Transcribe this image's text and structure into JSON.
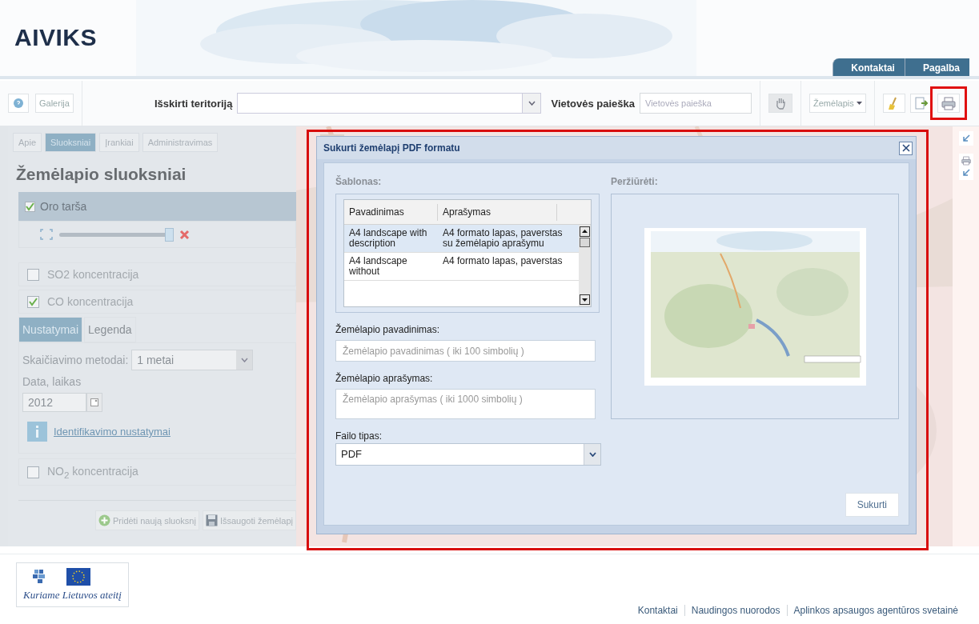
{
  "header": {
    "logo": "AIVIKS",
    "tabs": [
      "Kontaktai",
      "Pagalba"
    ]
  },
  "toolbar": {
    "gallery_button": "Galerija",
    "territory_label": "Išskirti teritoriją",
    "search_label": "Vietovės paieška",
    "search": {
      "placeholder": "Vietovės paieška"
    },
    "map_menu": "Žemėlapis",
    "tools": [
      {
        "kind": "broom",
        "highlighted": false
      },
      {
        "kind": "export",
        "highlighted": false
      },
      {
        "kind": "print",
        "highlighted": true
      }
    ]
  },
  "sidebar": {
    "tabs": [
      {
        "label": "Apie",
        "selected": false
      },
      {
        "label": "Sluoksniai",
        "selected": true
      },
      {
        "label": "Įrankiai",
        "selected": false
      },
      {
        "label": "Administravimas",
        "selected": false
      }
    ],
    "title": "Žemėlapio sluoksniai",
    "group": {
      "label": "Oro tarša",
      "checked": true,
      "opacity": {
        "level": 0.93
      }
    },
    "layers": [
      {
        "label": "SO2 koncentracija",
        "checked": false
      },
      {
        "label": "CO koncentracija",
        "checked": true,
        "settings": {
          "tabs": [
            {
              "label": "Nustatymai",
              "selected": true
            },
            {
              "label": "Legenda",
              "selected": false
            }
          ],
          "method_label": "Skaičiavimo metodai:",
          "method_value": "1 metai",
          "date_label": "Data, laikas",
          "date_value": "2012",
          "link": "Identifikavimo nustatymai"
        }
      },
      {
        "label": "NO$_{2}$ koncentracija",
        "checked": false
      }
    ],
    "add_button": "Pridėti naują sluoksnį",
    "save_button": "Išsaugoti žemėlapį"
  },
  "dialog": {
    "title": "Sukurti žemėlapį PDF formatu",
    "highlighted": true,
    "template_label": "Šablonas:",
    "template_columns": [
      "Pavadinimas",
      "Aprašymas"
    ],
    "templates": [
      {
        "name": "A4 landscape with description",
        "description": "A4 formato lapas, paverstas su žemėlapio aprašymu",
        "selected": true
      },
      {
        "name": "A4 landscape without",
        "description": "A4 formato lapas, paverstas",
        "selected": false
      }
    ],
    "name_label": "Žemėlapio pavadinimas:",
    "name_field": {
      "placeholder": "Žemėlapio pavadinimas ( iki 100 simbolių )"
    },
    "description_label": "Žemėlapio aprašymas:",
    "description_field": {
      "placeholder": "Žemėlapio aprašymas ( iki 1000 simbolių )"
    },
    "file_type_label": "Failo tipas:",
    "file_type": "PDF",
    "preview_label": "Peržiūrėti:",
    "create_button": "Sukurti"
  },
  "footer": {
    "logo_text": "Kuriame Lietuvos ateitį",
    "links": [
      "Kontaktai",
      "Naudingos nuorodos",
      "Aplinkos apsaugos agentūros svetainė"
    ]
  }
}
